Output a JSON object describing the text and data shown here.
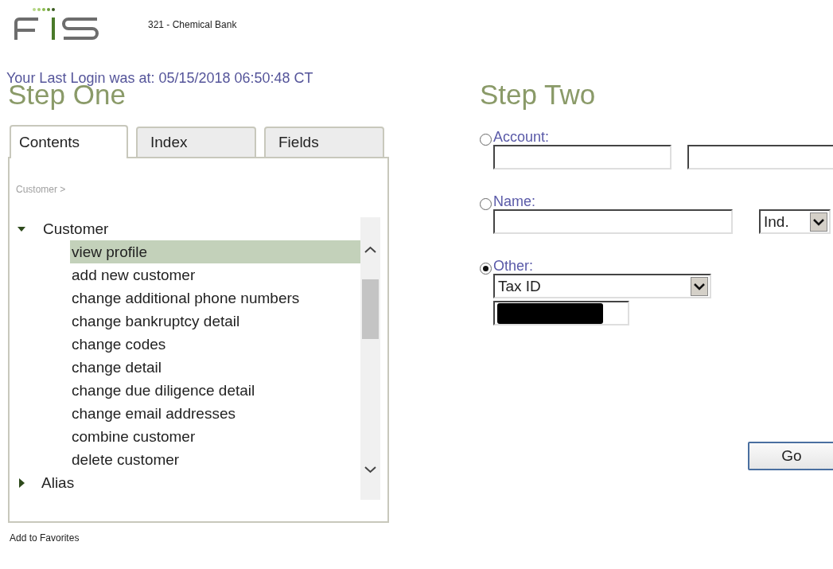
{
  "header": {
    "bank": "321 - Chemical Bank"
  },
  "last_login": "Your Last Login was at: 05/15/2018 06:50:48 CT",
  "step_one": {
    "title": "Step One",
    "tabs": [
      {
        "label": "Contents",
        "selected": true
      },
      {
        "label": "Index",
        "selected": false
      },
      {
        "label": "Fields",
        "selected": false
      }
    ],
    "breadcrumb": "Customer >",
    "tree": [
      {
        "label": "Customer",
        "expanded": true,
        "selected": false,
        "children": [
          {
            "label": "view profile",
            "selected": true
          },
          {
            "label": "add new customer",
            "selected": false
          },
          {
            "label": "change additional phone numbers",
            "selected": false
          },
          {
            "label": "change bankruptcy detail",
            "selected": false
          },
          {
            "label": "change codes",
            "selected": false
          },
          {
            "label": "change detail",
            "selected": false
          },
          {
            "label": "change due diligence detail",
            "selected": false
          },
          {
            "label": "change email addresses",
            "selected": false
          },
          {
            "label": "combine customer",
            "selected": false
          },
          {
            "label": "delete customer",
            "selected": false
          }
        ]
      },
      {
        "label": "Alias",
        "expanded": false,
        "selected": false
      }
    ],
    "add_to_favorites": "Add to Favorites"
  },
  "step_two": {
    "title": "Step Two",
    "options": [
      {
        "kind": "account",
        "label": "Account:",
        "selected": false
      },
      {
        "kind": "name",
        "label": "Name:",
        "selected": false,
        "type_select": "Ind."
      },
      {
        "kind": "other",
        "label": "Other:",
        "selected": true,
        "id_type": "Tax ID",
        "redacted": true
      }
    ],
    "go_button": "Go"
  }
}
